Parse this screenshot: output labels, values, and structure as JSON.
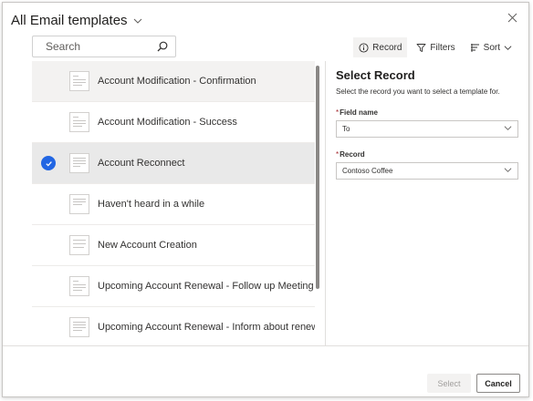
{
  "dialog": {
    "title": "All Email templates",
    "close_icon": "close-icon"
  },
  "search": {
    "placeholder": "Search",
    "icon": "search-icon"
  },
  "toolbar": {
    "record_label": "Record",
    "filters_label": "Filters",
    "sort_label": "Sort"
  },
  "templates": [
    {
      "label": "Account Modification - Confirmation",
      "state": "hover"
    },
    {
      "label": "Account Modification - Success",
      "state": "normal"
    },
    {
      "label": "Account Reconnect",
      "state": "selected"
    },
    {
      "label": "Haven't heard in a while",
      "state": "normal"
    },
    {
      "label": "New Account Creation",
      "state": "normal"
    },
    {
      "label": "Upcoming Account Renewal - Follow up Meeting",
      "state": "normal"
    },
    {
      "label": "Upcoming Account Renewal - Inform about renewal",
      "state": "normal"
    }
  ],
  "panel": {
    "title": "Select Record",
    "description": "Select the record you want to select a template for.",
    "field_name_label": "Field name",
    "field_name_value": "To",
    "record_label": "Record",
    "record_value": "Contoso Coffee",
    "required_marker": "*"
  },
  "footer": {
    "select_label": "Select",
    "cancel_label": "Cancel"
  },
  "colors": {
    "accent": "#2266e3",
    "required": "#a4262c"
  }
}
